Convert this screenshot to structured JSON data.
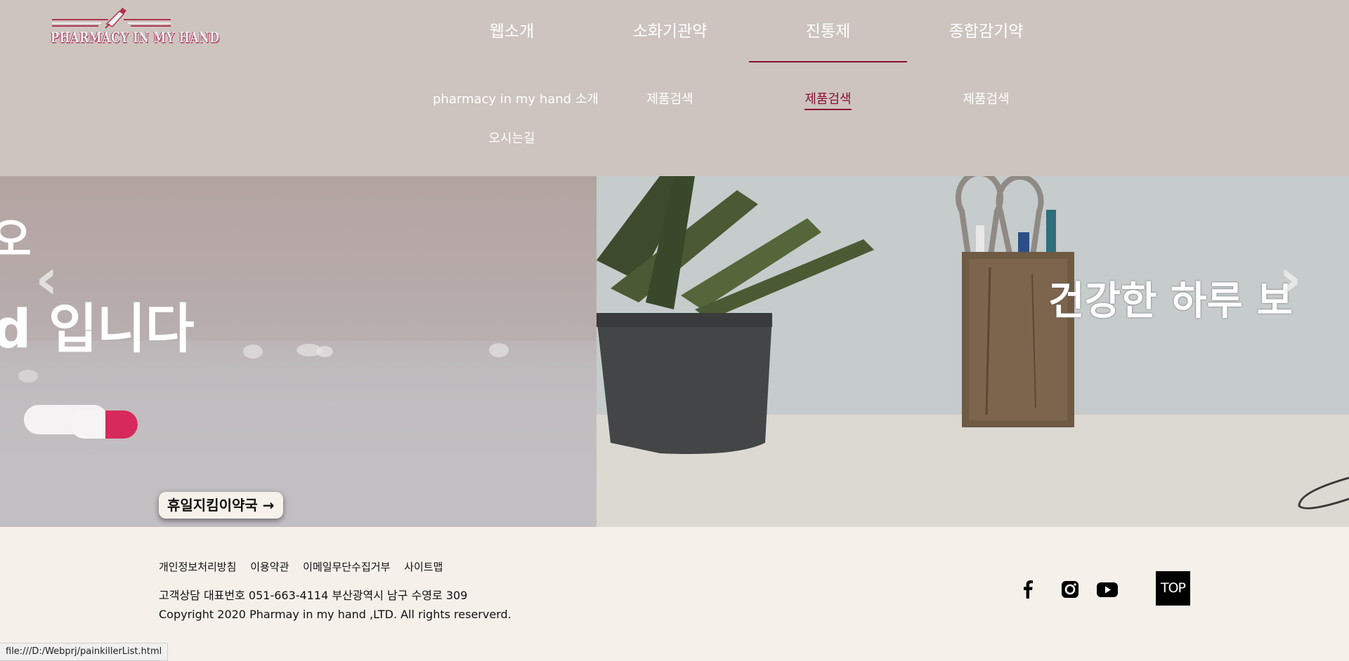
{
  "brand": {
    "logo_text": "PHARMACY IN MY HAND"
  },
  "nav": {
    "items": [
      {
        "label": "웹소개",
        "submenu": [
          "pharmacy in my hand 소개",
          "오시는길"
        ]
      },
      {
        "label": "소화기관약",
        "submenu": [
          "제품검색"
        ]
      },
      {
        "label": "진통제",
        "submenu": [
          "제품검색"
        ],
        "active": true
      },
      {
        "label": "종합감기약",
        "submenu": [
          "제품검색"
        ]
      }
    ]
  },
  "slider": {
    "slide1_line1": "오",
    "slide1_line2": "d 입니다",
    "slide2_text": "건강한 하루 보",
    "prev_icon": "‹",
    "next_icon": "›",
    "cta_label": "휴일지킴이약국 →"
  },
  "footer": {
    "links": [
      "개인정보처리방침",
      "이용약관",
      "이메일무단수집거부",
      "사이트맵"
    ],
    "contact": "고객상담 대표번호 051-663-4114 부산광역시 남구 수영로 309",
    "copyright": "Copyright 2020 Pharmay in my hand ,LTD. All rights reserverd.",
    "top_label": "TOP",
    "social": [
      "facebook-icon",
      "instagram-icon",
      "youtube-icon"
    ]
  },
  "status_url": "file:///D:/Webprj/painkillerList.html",
  "colors": {
    "header_bg": "#cdc4bf",
    "accent": "#8a1035",
    "footer_bg": "#f5f0ea"
  }
}
